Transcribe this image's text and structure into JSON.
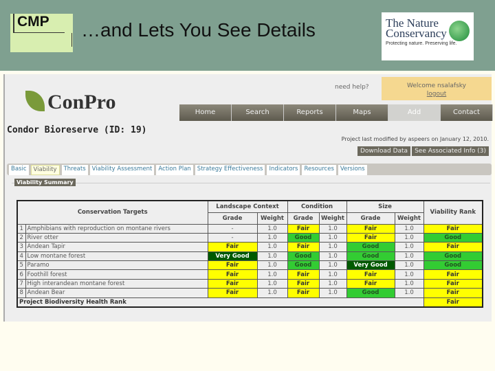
{
  "slide": {
    "cmp_label": "CMP",
    "title": "…and Lets You See Details",
    "tnc_line1": "The Nature",
    "tnc_line2": "Conservancy",
    "tnc_tagline": "Protecting nature. Preserving life."
  },
  "app": {
    "logo": "ConPro",
    "help": "need help?",
    "welcome": "Welcome nsalafsky",
    "logout": "logout",
    "nav": [
      "Home",
      "Search",
      "Reports",
      "Maps",
      "Add",
      "Contact"
    ],
    "project_title": "Condor Bioreserve (ID: 19)",
    "modified": "Project last modified by aspeers on January 12, 2010.",
    "download": "Download Data",
    "associated": "See Associated Info (3)",
    "tabs": [
      "Basic",
      "Viability",
      "Threats",
      "Viability Assessment",
      "Action Plan",
      "Strategy Effectiveness",
      "Indicators",
      "Resources",
      "Versions"
    ],
    "section": "Viability Summary"
  },
  "table": {
    "h_targets": "Conservation Targets",
    "h_lc": "Landscape Context",
    "h_cond": "Condition",
    "h_size": "Size",
    "h_rank": "Viability Rank",
    "h_grade": "Grade",
    "h_weight": "Weight",
    "rows": [
      {
        "n": "1",
        "name": "Amphibians with reproduction on montane rivers",
        "lc": "-",
        "lcw": "1.0",
        "c": "Fair",
        "cw": "1.0",
        "s": "Fair",
        "sw": "1.0",
        "r": "Fair"
      },
      {
        "n": "2",
        "name": "River otter",
        "lc": "-",
        "lcw": "1.0",
        "c": "Good",
        "cw": "1.0",
        "s": "Fair",
        "sw": "1.0",
        "r": "Good"
      },
      {
        "n": "3",
        "name": "Andean Tapir",
        "lc": "Fair",
        "lcw": "1.0",
        "c": "Fair",
        "cw": "1.0",
        "s": "Good",
        "sw": "1.0",
        "r": "Fair"
      },
      {
        "n": "4",
        "name": "Low montane forest",
        "lc": "Very Good",
        "lcw": "1.0",
        "c": "Good",
        "cw": "1.0",
        "s": "Good",
        "sw": "1.0",
        "r": "Good"
      },
      {
        "n": "5",
        "name": "Paramo",
        "lc": "Fair",
        "lcw": "1.0",
        "c": "Good",
        "cw": "1.0",
        "s": "Very Good",
        "sw": "1.0",
        "r": "Good"
      },
      {
        "n": "6",
        "name": "Foothill forest",
        "lc": "Fair",
        "lcw": "1.0",
        "c": "Fair",
        "cw": "1.0",
        "s": "Fair",
        "sw": "1.0",
        "r": "Fair"
      },
      {
        "n": "7",
        "name": "High interandean montane forest",
        "lc": "Fair",
        "lcw": "1.0",
        "c": "Fair",
        "cw": "1.0",
        "s": "Fair",
        "sw": "1.0",
        "r": "Fair"
      },
      {
        "n": "8",
        "name": "Andean Bear",
        "lc": "Fair",
        "lcw": "1.0",
        "c": "Fair",
        "cw": "1.0",
        "s": "Good",
        "sw": "1.0",
        "r": "Fair"
      }
    ],
    "footer_label": "Project Biodiversity Health Rank",
    "footer_rank": "Fair"
  }
}
